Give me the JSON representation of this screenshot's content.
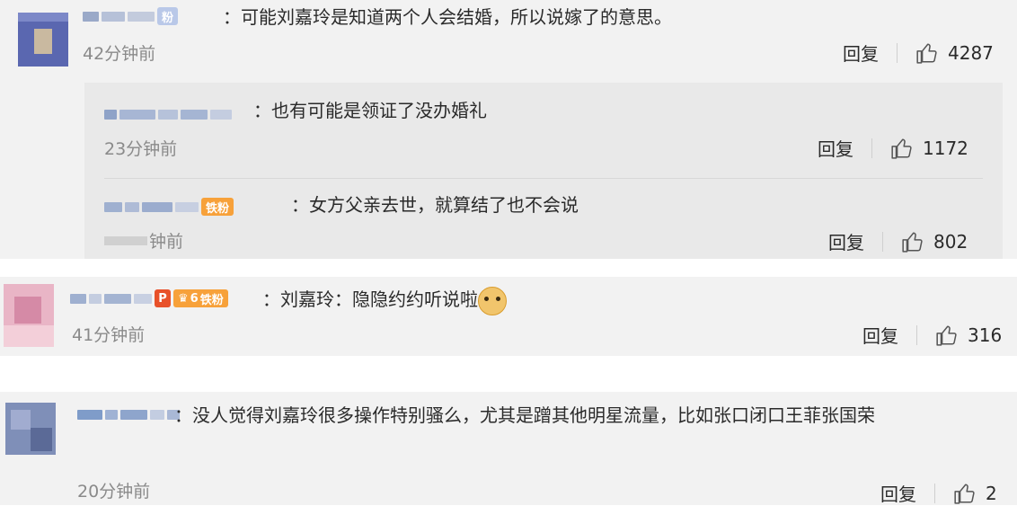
{
  "comments": [
    {
      "badge": "粉",
      "text": "：可能刘嘉玲是知道两个人会结婚，所以说嫁了的意思。",
      "time": "42分钟前",
      "reply_label": "回复",
      "likes": "4287",
      "replies": [
        {
          "text": "：也有可能是领证了没办婚礼",
          "time": "23分钟前",
          "reply_label": "回复",
          "likes": "1172"
        },
        {
          "badge": "铁粉",
          "text": "：女方父亲去世，就算结了也不会说",
          "time": "钟前",
          "reply_label": "回复",
          "likes": "802"
        }
      ]
    },
    {
      "badge_level": "6",
      "badge": "铁粉",
      "text": "：刘嘉玲：隐隐约约听说啦",
      "emoji": "doge",
      "time": "41分钟前",
      "reply_label": "回复",
      "likes": "316"
    },
    {
      "text": "：没人觉得刘嘉玲很多操作特别骚么，尤其是蹭其他明星流量，比如张口闭口王菲张国荣",
      "time": "20分钟前",
      "reply_label": "回复",
      "likes": "2"
    }
  ],
  "icons": {
    "like": "thumbs-up-icon"
  },
  "colors": {
    "card_bg": "#f2f2f2",
    "reply_bg": "#e9e9e9",
    "time": "#8a8a8a",
    "badge_orange": "#f7a13a"
  }
}
